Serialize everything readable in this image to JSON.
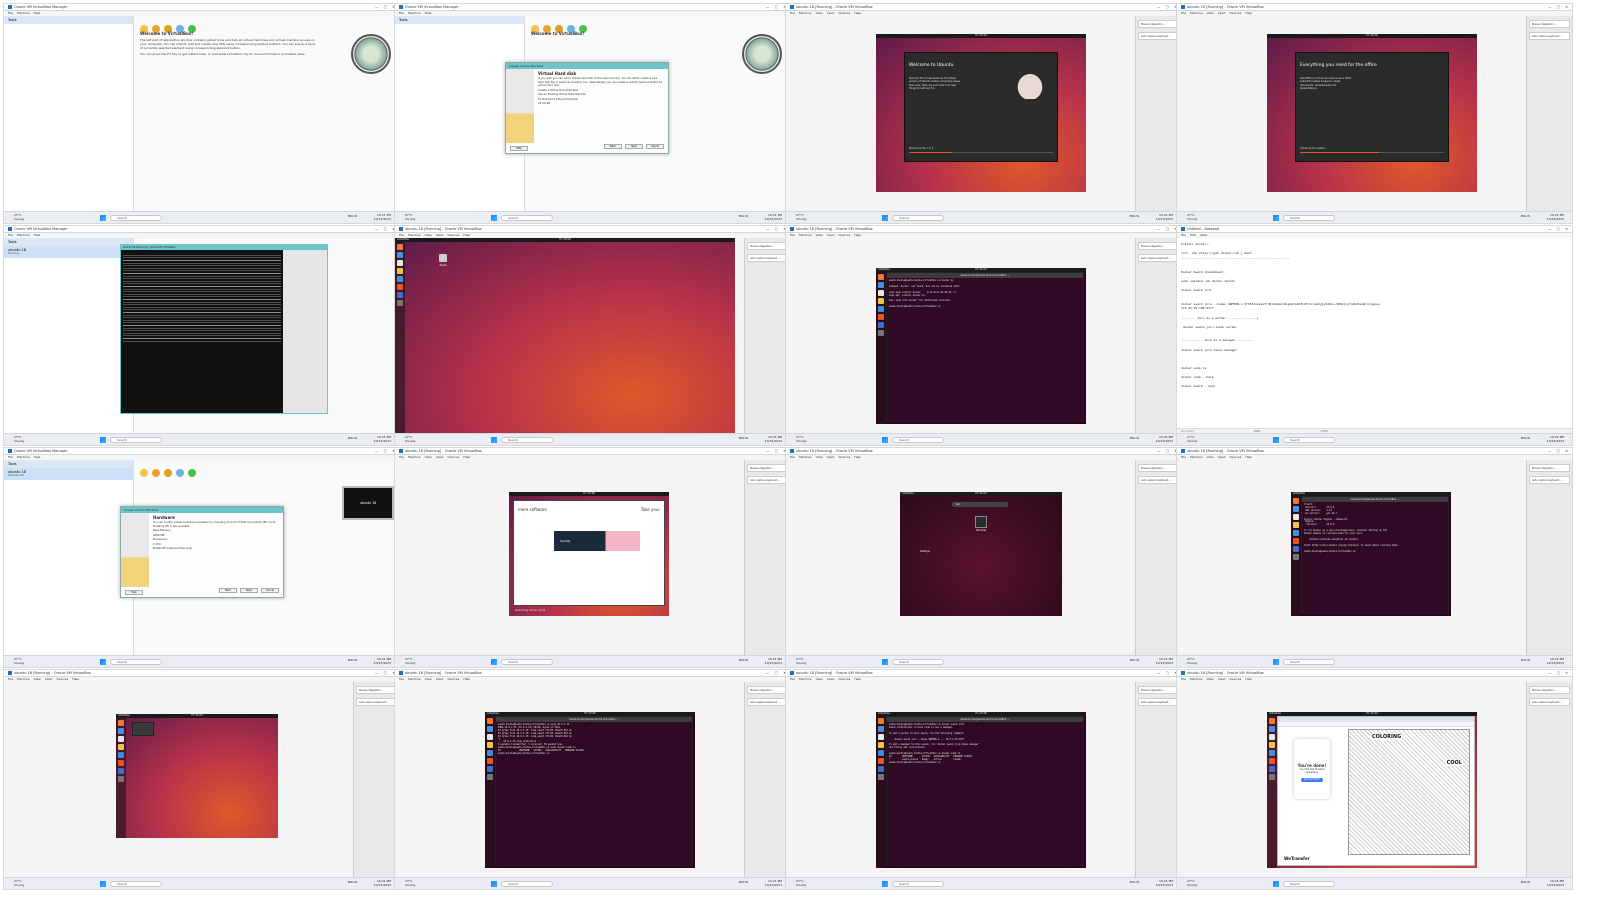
{
  "common": {
    "search_placeholder": "Search",
    "weather_temp": "27°C",
    "weather_text": "Cloudy",
    "tray_lang": "ENG IN",
    "clock_time": "10:21 PM",
    "clock_date": "10/15/2023",
    "vbox_side_notice_1": "Mouse integration ...",
    "vbox_side_notice_2": "Auto capture keyboard ..."
  },
  "tiles": [
    {
      "id": "t1",
      "title": "Oracle VM VirtualBox Manager",
      "menu": [
        "File",
        "Machine",
        "Help"
      ],
      "tools": "Tools",
      "welcome_title": "Welcome to VirtualBox!",
      "welcome_text": "The left part of application window contains global tools and lists all virtual machines and virtual machine groups on your computer. You can import, add and create new VMs using corresponding toolbar buttons. You can popup a tools of currently selected element using corresponding element button.",
      "welcome_text2": "You can press the F1 key to get instant help, or visit www.virtualbox.org for more information and latest news.",
      "toolbar": [
        "Preferences",
        "Import",
        "Export",
        "New",
        "Add"
      ]
    },
    {
      "id": "t2",
      "title": "Oracle VM VirtualBox Manager",
      "menu": [
        "File",
        "Machine",
        "Help"
      ],
      "tools": "Tools",
      "welcome_title": "Welcome to VirtualBox!",
      "dialog_title": "Create Virtual Machine",
      "dialog_head": "Virtual Hard disk",
      "dialog_text": "If you wish you can add a virtual hard disk to the new machine. You can either create a new hard disk file or select an existing one. Alternatively you can create a virtual machine without a virtual hard disk.",
      "opt1": "Create a Virtual Hard Disk Now",
      "opt2": "Use an Existing Virtual Hard Disk File",
      "opt3": "Do Not Add a Virtual Hard Disk",
      "disk_size": "25.00 GB",
      "buttons": [
        "Back",
        "Next",
        "Cancel"
      ],
      "help": "Help"
    },
    {
      "id": "t3",
      "title": "ubuntu 18 [Running] - Oracle VM VirtualBox",
      "menu": [
        "File",
        "Machine",
        "View",
        "Input",
        "Devices",
        "Help"
      ],
      "ub_clock": "Fri 10:15",
      "welcome": "Welcome to Ubuntu",
      "welcome_text": "Fast and full of new features, the latest version of Ubuntu makes computing easier than ever. Here are just a few cool new things to look out for...",
      "progress_label": "Retrieving file 1 of 3"
    },
    {
      "id": "t4",
      "title": "ubuntu 18 [Running] - Oracle VM VirtualBox",
      "menu": [
        "File",
        "Machine",
        "View",
        "Input",
        "Devices",
        "Help"
      ],
      "ub_clock": "Fri 10:16",
      "welcome": "Everything you need for the office",
      "welcome_text": "LibreOffice is a free and open-source office suite that makes it easy to create documents, spreadsheets and presentations.",
      "progress_label": "Installing the system..."
    },
    {
      "id": "t5",
      "title": "Oracle VM VirtualBox Manager",
      "menu": [
        "File",
        "Machine",
        "Help"
      ],
      "tools": "Tools",
      "vm_name": "ubuntu 18",
      "vm_state": "Running",
      "console_title": "ubuntu 18 [Running] - Oracle VM VirtualBox"
    },
    {
      "id": "t6",
      "title": "ubuntu 18 [Running] - Oracle VM VirtualBox",
      "menu": [
        "File",
        "Machine",
        "View",
        "Input",
        "Devices",
        "Help"
      ],
      "ub_activities": "Activities",
      "ub_clock": "Fri 10:59",
      "trash": "Trash"
    },
    {
      "id": "t7",
      "title": "ubuntu 18 [Running] - Oracle VM VirtualBox",
      "menu": [
        "File",
        "Machine",
        "View",
        "Input",
        "Devices",
        "Help"
      ],
      "ub_activities": "Activities",
      "ub_clock": "Fri 11:03",
      "terminal_title": "sweta-techie@sweta-techie-VirtualBox: ~"
    },
    {
      "id": "t8",
      "title": "Untitled - Notepad",
      "menu": [
        "File",
        "Edit",
        "View"
      ],
      "status_pos": "Ln 1, Col 1",
      "status_zoom": "100%",
      "status_enc": "UTF-8"
    },
    {
      "id": "t9",
      "title": "Oracle VM VirtualBox Manager",
      "menu": [
        "File",
        "Machine",
        "Help"
      ],
      "tools": "Tools",
      "vm_name": "ubuntu 18",
      "vm_state": "Powered Off",
      "dialog_title": "Create Virtual Machine",
      "dialog_head": "Hardware",
      "dialog_text": "You can modify virtual machine's hardware by changing amount of RAM and virtual CPU count. Enabling EFI is also possible.",
      "mem_label": "Base Memory:",
      "mem_value": "4096 MB",
      "cpu_label": "Processors:",
      "cpu_value": "1 CPU",
      "efi": "Enable EFI (special OSes only)",
      "buttons": [
        "Back",
        "Next",
        "Cancel"
      ],
      "help": "Help",
      "preview_text": "ubuntu 18"
    },
    {
      "id": "t10",
      "title": "ubuntu 18 [Running] - Oracle VM VirtualBox",
      "menu": [
        "File",
        "Machine",
        "View",
        "Input",
        "Devices",
        "Help"
      ],
      "ub_clock": "Fri 17:48",
      "header_left": "more software",
      "header_right": "Take your",
      "app_featured": "Spotify",
      "install_label": "Welcoming Ubuntu 18.04"
    },
    {
      "id": "t11",
      "title": "ubuntu 18 [Running] - Oracle VM VirtualBox",
      "menu": [
        "File",
        "Machine",
        "View",
        "Input",
        "Devices",
        "Help"
      ],
      "ub_activities": "Activities",
      "ub_clock": "Fri 11:02",
      "search_text": "terl",
      "result_app": "Terminal",
      "result_settings": "Settings"
    },
    {
      "id": "t12",
      "title": "ubuntu 18 [Running] - Oracle VM VirtualBox",
      "menu": [
        "File",
        "Machine",
        "View",
        "Input",
        "Devices",
        "Help"
      ],
      "ub_activities": "Activities",
      "terminal_title": "sweta-techie@sweta-techie-VirtualBox: ~"
    },
    {
      "id": "t13",
      "title": "ubuntu 18 [Running] - Oracle VM VirtualBox",
      "menu": [
        "File",
        "Machine",
        "View",
        "Input",
        "Devices",
        "Help"
      ],
      "ub_activities": "Activities",
      "ub_clock": "Fri 11:03"
    },
    {
      "id": "t14",
      "title": "ubuntu 18 [Running] - Oracle VM VirtualBox",
      "menu": [
        "File",
        "Machine",
        "View",
        "Input",
        "Devices",
        "Help"
      ],
      "ub_activities": "Activities",
      "ub_clock": "Fri 17:20",
      "terminal_title": "sweta-techie@sweta-techie-VirtualBox: ~"
    },
    {
      "id": "t15",
      "title": "ubuntu 18 [Running] - Oracle VM VirtualBox",
      "menu": [
        "File",
        "Machine",
        "View",
        "Input",
        "Devices",
        "Help"
      ],
      "ub_activities": "Activities",
      "ub_clock": "Fri 17:26",
      "terminal_title": "sweta-techie@sweta-techie-VirtualBox: ~"
    },
    {
      "id": "t16",
      "title": "ubuntu 18 [Running] - Oracle VM VirtualBox",
      "menu": [
        "File",
        "Machine",
        "View",
        "Input",
        "Devices",
        "Help"
      ],
      "ub_activities": "Activities",
      "ub_clock": "Fri 17:44",
      "done": "You're done!",
      "done_text": "Your file has finished uploading.",
      "wt_button": "Send another?",
      "coloring": "COLORING",
      "cool": "COOL",
      "wetransfer": "WeTransfer"
    }
  ],
  "terminal_texts": {
    "t7": "sweta-techie@sweta-techie-VirtualBox:~$ docker ps\n\nCommand 'docker' not found, but can be installed with:\n\nsudo snap install docker     # version 20.10.24, or\nsudo apt  install docker.io\n\nSee 'snap info docker' for additional versions.\n\nsweta-techie@sweta-techie-VirtualBox:~$",
    "t12": "Client:\n Version:        24.0.6\n API version:    1.43\n Go version:     go1.20.7\n\nServer: Docker Engine - Community\n Engine:\n  Version:       24.0.6\n\nTo run Docker as a non-privileged user, consider setting up the\nDocker daemon in rootless mode for your user:\n\n    dockerd-rootless-setuptool.sh install\n\nVisit https://docs.docker.com/go/rootless/ to learn about rootless mode.\n\nsweta-techie@sweta-techie-VirtualBox:~$",
    "t14": "sweta-techie@sweta-techie-VirtualBox:~$ ping 10.0.2.15\nPING 10.0.2.15 (10.0.2.15) 56(84) bytes of data.\n64 bytes from 10.0.2.15: icmp_seq=1 ttl=64 time=0.021 ms\n64 bytes from 10.0.2.15: icmp_seq=2 ttl=64 time=0.043 ms\n64 bytes from 10.0.2.15: icmp_seq=3 ttl=64 time=0.044 ms\n^C\n--- 10.0.2.15 ping statistics ---\n3 packets transmitted, 3 received, 0% packet loss\nsweta-techie@sweta-techie-VirtualBox:~$ sudo docker node ls\nID              HOSTNAME   STATUS   AVAILABILITY   MANAGER STATUS\nsweta-techie@sweta-techie-VirtualBox:~$",
    "t15": "sweta-techie@sweta-techie-VirtualBox:~$ docker swarm init\nSwarm initialized: current node is now a manager.\n\nTo add a worker to this swarm, run the following command:\n\n    docker swarm join --token SWMTKN-1-... 10.0.2.15:2377\n\nTo add a manager to this swarm, run 'docker swarm join-token manager'\nand follow the instructions.\n\nsweta-techie@sweta-techie-VirtualBox:~$ docker node ls\nID        HOSTNAME       STATUS   AVAILABILITY   MANAGER STATUS\n*         sweta-techie   Ready    Active         Leader\nsweta-techie@sweta-techie-VirtualBox:~$"
  },
  "notepad_text": "Install docker:-\n\ncurl -sSL https://get.docker.com | bash\n------------------------------------------------------------\n\n\nDocker Swarm Cheatsheet:-\n\nsudo usermod -aG docker ubuntu\n\ndocker swarm init\n\n\ndocker swarm join --token SWMTKN-1-5fh53ce1sakfrd9jdmzpnl8igdeto4d3l2fclrnukhgjy6d61s-9961jnnfom91hsq6rorpqpeu\n172.31.29.190:2377\n\n-------- Join as a worker ----------------|\n\n docker swarm join-token worker\n\n\n------------ Join as a manager ---------\n\ndocker swarm join-token manager\n\n\n\ndocker node ls\n\ndocker node --help\n\ndocker swarm --help",
  "colors": {
    "ubuntu_orange": "#e95420",
    "terminal_bg": "#300a24",
    "vbox_accent": "#1f6fbf"
  }
}
